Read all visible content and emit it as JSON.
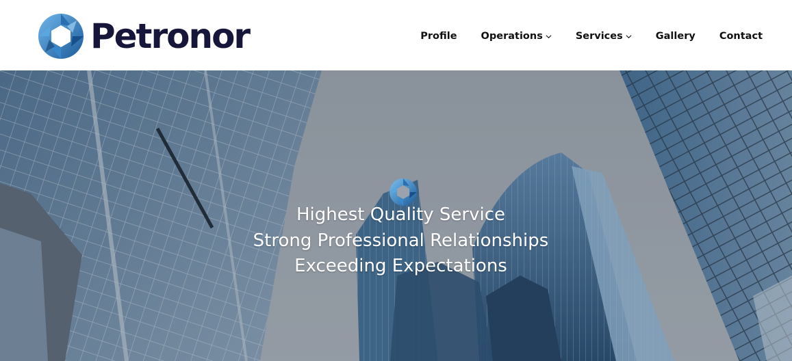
{
  "brand": {
    "name": "Petronor",
    "logo_icon": "aperture-ring-icon",
    "colors": {
      "wordmark": "#16163a",
      "ring_dark": "#1d5d9c",
      "ring_light": "#5aa7e0"
    }
  },
  "nav": {
    "items": [
      {
        "label": "Profile",
        "has_dropdown": false
      },
      {
        "label": "Operations",
        "has_dropdown": true
      },
      {
        "label": "Services",
        "has_dropdown": true
      },
      {
        "label": "Gallery",
        "has_dropdown": false
      },
      {
        "label": "Contact",
        "has_dropdown": false
      }
    ]
  },
  "hero": {
    "icon": "aperture-ring-icon",
    "lines": [
      "Highest Quality Service",
      "Strong Professional Relationships",
      "Exceeding Expectations"
    ]
  }
}
